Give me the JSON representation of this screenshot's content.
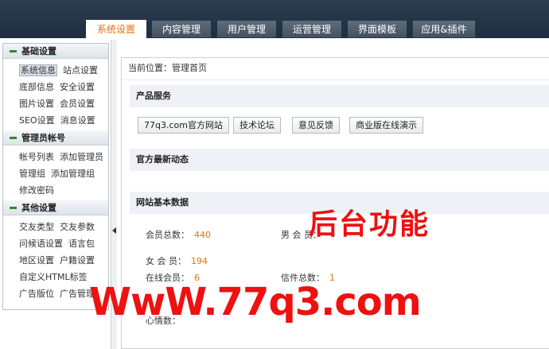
{
  "nav": {
    "tabs": [
      "系统设置",
      "内容管理",
      "用户管理",
      "运营管理",
      "界面模板",
      "应用&插件"
    ],
    "active": 0
  },
  "sidebar": {
    "groups": [
      {
        "title": "基础设置",
        "rows": [
          [
            "系统信息",
            "站点设置"
          ],
          [
            "底部信息",
            "安全设置"
          ],
          [
            "图片设置",
            "会员设置"
          ],
          [
            "SEO设置",
            "消息设置"
          ]
        ]
      },
      {
        "title": "管理员帐号",
        "rows": [
          [
            "帐号列表",
            "添加管理员"
          ],
          [
            "管理组",
            "添加管理组"
          ],
          [
            "修改密码"
          ]
        ]
      },
      {
        "title": "其他设置",
        "rows": [
          [
            "交友类型",
            "交友参数"
          ],
          [
            "问候语设置",
            "语言包"
          ],
          [
            "地区设置",
            "户籍设置"
          ],
          [
            "自定义HTML标签"
          ],
          [
            "广告版位",
            "广告管理"
          ]
        ]
      }
    ],
    "selected": "系统信息"
  },
  "main": {
    "breadcrumb": "当前位置：管理首页",
    "product_title": "产品服务",
    "buttons": [
      "77q3.com官方网站",
      "技术论坛",
      "意见反馈",
      "商业版在线演示"
    ],
    "news_title": "官方最新动态",
    "stats_title": "网站基本数据",
    "stats": {
      "members_label": "会员总数：",
      "members": "440",
      "male_label": "男 会 员：",
      "male": "",
      "female_label": "女 会 员：",
      "female": "194",
      "online_label": "在线会员：",
      "online": "6",
      "mail_label": "信件总数：",
      "mail": "1",
      "row4a_label": "",
      "row5a_label": "心情数："
    }
  },
  "overlay": {
    "feature_text": "后台功能",
    "site_text": "WwW.77q3.com"
  },
  "colors": {
    "accent": "#e8700c",
    "overlay": "#ef1010",
    "topbar": "#24364a"
  }
}
